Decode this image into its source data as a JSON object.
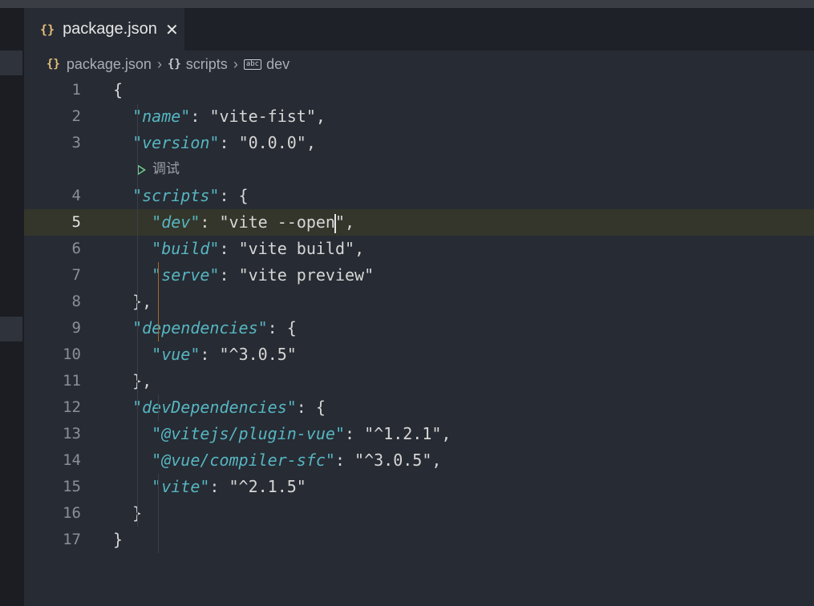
{
  "tab": {
    "icon": "json-braces-icon",
    "label": "package.json",
    "close_icon": "close-icon"
  },
  "breadcrumb": {
    "items": [
      {
        "icon": "json-braces-icon",
        "label": "package.json"
      },
      {
        "icon": "object-braces-icon",
        "label": "scripts"
      },
      {
        "icon": "string-abc-icon",
        "label": "dev"
      }
    ],
    "abc_text": "abc"
  },
  "codelens": {
    "icon": "run-debug-icon",
    "label": "调试"
  },
  "colors": {
    "key": "#56b6c2",
    "current_line": "#34362b",
    "bracket_guide": "#a86a2e",
    "codelens_play": "#73c991"
  },
  "current_line": 5,
  "lines": [
    {
      "num": "1",
      "tokens": [
        {
          "t": "punc",
          "v": "{"
        }
      ]
    },
    {
      "num": "2",
      "tokens": [
        {
          "t": "ws",
          "v": "  "
        },
        {
          "t": "key",
          "v": "\"name\""
        },
        {
          "t": "punc",
          "v": ": "
        },
        {
          "t": "str",
          "v": "\"vite-fist\""
        },
        {
          "t": "punc",
          "v": ","
        }
      ]
    },
    {
      "num": "3",
      "tokens": [
        {
          "t": "ws",
          "v": "  "
        },
        {
          "t": "key",
          "v": "\"version\""
        },
        {
          "t": "punc",
          "v": ": "
        },
        {
          "t": "str",
          "v": "\"0.0.0\""
        },
        {
          "t": "punc",
          "v": ","
        }
      ]
    },
    {
      "num": "4",
      "tokens": [
        {
          "t": "ws",
          "v": "  "
        },
        {
          "t": "key",
          "v": "\"scripts\""
        },
        {
          "t": "punc",
          "v": ": {"
        }
      ]
    },
    {
      "num": "5",
      "tokens": [
        {
          "t": "ws",
          "v": "    "
        },
        {
          "t": "key",
          "v": "\"dev\""
        },
        {
          "t": "punc",
          "v": ": "
        },
        {
          "t": "str",
          "v": "\"vite --open"
        },
        {
          "t": "cursor",
          "v": ""
        },
        {
          "t": "str",
          "v": "\""
        },
        {
          "t": "punc",
          "v": ","
        }
      ]
    },
    {
      "num": "6",
      "tokens": [
        {
          "t": "ws",
          "v": "    "
        },
        {
          "t": "key",
          "v": "\"build\""
        },
        {
          "t": "punc",
          "v": ": "
        },
        {
          "t": "str",
          "v": "\"vite build\""
        },
        {
          "t": "punc",
          "v": ","
        }
      ]
    },
    {
      "num": "7",
      "tokens": [
        {
          "t": "ws",
          "v": "    "
        },
        {
          "t": "key",
          "v": "\"serve\""
        },
        {
          "t": "punc",
          "v": ": "
        },
        {
          "t": "str",
          "v": "\"vite preview\""
        }
      ]
    },
    {
      "num": "8",
      "tokens": [
        {
          "t": "ws",
          "v": "  "
        },
        {
          "t": "punc",
          "v": "},"
        }
      ]
    },
    {
      "num": "9",
      "tokens": [
        {
          "t": "ws",
          "v": "  "
        },
        {
          "t": "key",
          "v": "\"dependencies\""
        },
        {
          "t": "punc",
          "v": ": {"
        }
      ]
    },
    {
      "num": "10",
      "tokens": [
        {
          "t": "ws",
          "v": "    "
        },
        {
          "t": "key",
          "v": "\"vue\""
        },
        {
          "t": "punc",
          "v": ": "
        },
        {
          "t": "str",
          "v": "\"^3.0.5\""
        }
      ]
    },
    {
      "num": "11",
      "tokens": [
        {
          "t": "ws",
          "v": "  "
        },
        {
          "t": "punc",
          "v": "},"
        }
      ]
    },
    {
      "num": "12",
      "tokens": [
        {
          "t": "ws",
          "v": "  "
        },
        {
          "t": "key",
          "v": "\"devDependencies\""
        },
        {
          "t": "punc",
          "v": ": {"
        }
      ]
    },
    {
      "num": "13",
      "tokens": [
        {
          "t": "ws",
          "v": "    "
        },
        {
          "t": "key",
          "v": "\"@vitejs/plugin-vue\""
        },
        {
          "t": "punc",
          "v": ": "
        },
        {
          "t": "str",
          "v": "\"^1.2.1\""
        },
        {
          "t": "punc",
          "v": ","
        }
      ]
    },
    {
      "num": "14",
      "tokens": [
        {
          "t": "ws",
          "v": "    "
        },
        {
          "t": "key",
          "v": "\"@vue/compiler-sfc\""
        },
        {
          "t": "punc",
          "v": ": "
        },
        {
          "t": "str",
          "v": "\"^3.0.5\""
        },
        {
          "t": "punc",
          "v": ","
        }
      ]
    },
    {
      "num": "15",
      "tokens": [
        {
          "t": "ws",
          "v": "    "
        },
        {
          "t": "key",
          "v": "\"vite\""
        },
        {
          "t": "punc",
          "v": ": "
        },
        {
          "t": "str",
          "v": "\"^2.1.5\""
        }
      ]
    },
    {
      "num": "16",
      "tokens": [
        {
          "t": "ws",
          "v": "  "
        },
        {
          "t": "punc",
          "v": "}"
        }
      ]
    },
    {
      "num": "17",
      "tokens": [
        {
          "t": "punc",
          "v": "}"
        }
      ]
    }
  ]
}
